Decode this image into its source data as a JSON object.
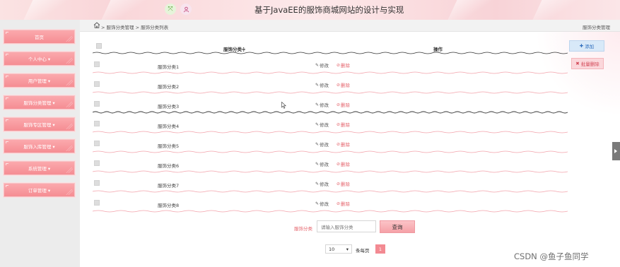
{
  "header": {
    "title": "基于JavaEE的服饰商城网站的设计与实现",
    "icons": [
      "expand-icon",
      "user-icon"
    ]
  },
  "sidebar": {
    "items": [
      {
        "label": "首页"
      },
      {
        "label": "个人中心 ▾"
      },
      {
        "label": "用户管理 ▾"
      },
      {
        "label": "服饰分类管理 ▾"
      },
      {
        "label": "服饰专区管理 ▾"
      },
      {
        "label": "服饰入库管理 ▾"
      },
      {
        "label": "系统管理 ▾"
      },
      {
        "label": "订单管理 ▾"
      }
    ]
  },
  "breadcrumb": {
    "text": "> 服饰分类管理 > 服饰分类列表",
    "right": "服饰分类管理"
  },
  "table": {
    "columns": [
      "服饰分类≑",
      "操作"
    ],
    "rows": [
      {
        "name": "服饰分类1"
      },
      {
        "name": "服饰分类2"
      },
      {
        "name": "服饰分类3"
      },
      {
        "name": "服饰分类4"
      },
      {
        "name": "服饰分类5"
      },
      {
        "name": "服饰分类6"
      },
      {
        "name": "服饰分类7"
      },
      {
        "name": "服饰分类8"
      }
    ],
    "edit_label": "修改",
    "delete_label": "删除"
  },
  "actions": {
    "add_label": "添加",
    "batch_delete_label": "批量删除"
  },
  "search": {
    "label": "服饰分类",
    "placeholder": "请输入服饰分类",
    "button_label": "查询"
  },
  "pagination": {
    "page_size": "10",
    "per_page_label": "条每页",
    "current_page": "1"
  },
  "watermark": "CSDN @鱼子鱼同学",
  "colors": {
    "accent": "#f58d93",
    "delete": "#e5636b",
    "add": "#2f6ebd"
  }
}
